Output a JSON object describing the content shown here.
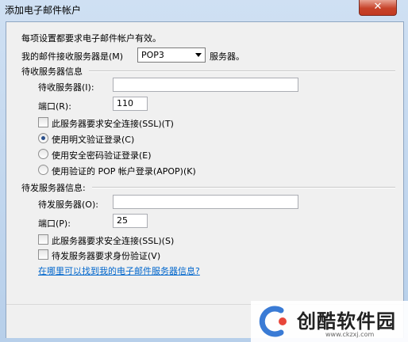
{
  "window": {
    "title": "添加电子邮件帐户",
    "close_label": "✕"
  },
  "intro": "每项设置都要求电子邮件帐户有效。",
  "account_type": {
    "prefix": "我的邮件接收服务器是(M)",
    "value": "POP3",
    "suffix": "服务器。"
  },
  "incoming": {
    "section_label": "待收服务器信息",
    "server_label": "待收服务器(I):",
    "server_value": "",
    "port_label": "端口(R):",
    "port_value": "110",
    "ssl_label": "此服务器要求安全连接(SSL)(T)",
    "auth_options": [
      {
        "label": "使用明文验证登录(C)",
        "selected": true
      },
      {
        "label": "使用安全密码验证登录(E)",
        "selected": false
      },
      {
        "label": "使用验证的 POP 帐户登录(APOP)(K)",
        "selected": false
      }
    ]
  },
  "outgoing": {
    "section_label": "待发服务器信息:",
    "server_label": "待发服务器(O):",
    "server_value": "",
    "port_label": "端口(P):",
    "port_value": "25",
    "ssl_label": "此服务器要求安全连接(SSL)(S)",
    "auth_label": "待发服务器要求身份验证(V)"
  },
  "help_link": "在哪里可以找到我的电子邮件服务器信息?",
  "watermark": {
    "brand": "创酷软件园",
    "url": "www.ckzxj.com"
  },
  "colors": {
    "link": "#0066cc",
    "close": "#c7432a",
    "logo_blue": "#3a7bd5",
    "logo_red": "#e8463a"
  }
}
